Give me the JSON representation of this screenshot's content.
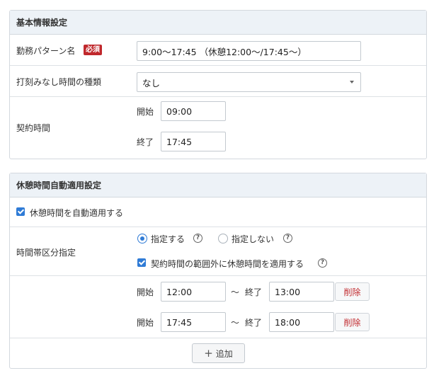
{
  "basic_section": {
    "title": "基本情報設定",
    "pattern_name_label": "勤務パターン名",
    "required_badge": "必須",
    "pattern_name_value": "9:00～17:45 （休憩12:00～/17:45～）",
    "stamp_type_label": "打刻みなし時間の種類",
    "stamp_type_value": "なし",
    "contract_time_label": "契約時間",
    "start_label": "開始",
    "start_value": "09:00",
    "end_label": "終了",
    "end_value": "17:45"
  },
  "break_section": {
    "title": "休憩時間自動適用設定",
    "auto_apply_label": "休憩時間を自動適用する",
    "auto_apply_checked": true,
    "time_zone_label": "時間帯区分指定",
    "radio_specify_label": "指定する",
    "radio_no_specify_label": "指定しない",
    "radio_selected": "指定する",
    "outside_contract_label": "契約時間の範囲外に休憩時間を適用する",
    "outside_contract_checked": true,
    "help_glyph": "?",
    "breaks": [
      {
        "start_label": "開始",
        "start_value": "12:00",
        "separator": "～",
        "end_label": "終了",
        "end_value": "13:00",
        "delete_label": "削除"
      },
      {
        "start_label": "開始",
        "start_value": "17:45",
        "separator": "～",
        "end_label": "終了",
        "end_value": "18:00",
        "delete_label": "削除"
      }
    ],
    "add_button_label": "追加",
    "add_icon": "plus-icon"
  },
  "colors": {
    "accent": "#2f7bd6",
    "danger": "#c0282c",
    "header_bg": "#edf2f7"
  }
}
